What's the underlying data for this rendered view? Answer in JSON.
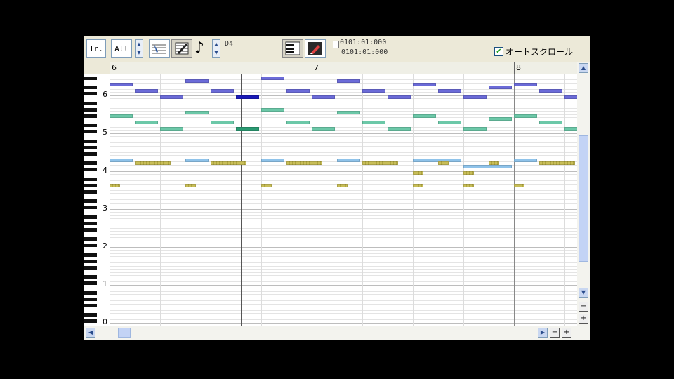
{
  "toolbar": {
    "track_button": "Tr.",
    "track_select": "All",
    "note_length": "D4",
    "position_top": "0101:01:000",
    "position_bottom": "0101:01:000",
    "autoscroll_label": "オートスクロール",
    "autoscroll_checked": true
  },
  "ruler": {
    "measures": [
      "6",
      "7",
      "8"
    ]
  },
  "keyboard": {
    "octaves": [
      "6",
      "5",
      "4",
      "3",
      "2",
      "1",
      "0"
    ]
  },
  "colors": {
    "purple": "#6b6bd8",
    "dark_blue": "#1a1ab8",
    "teal": "#6cc8a8",
    "dark_teal": "#2a9a72",
    "light_blue": "#8fc3ea",
    "olive": "#c8be58"
  },
  "piano_roll": {
    "notes": [
      {
        "beat": 0.0,
        "len": 0.5,
        "pitch": 88,
        "color": "purple"
      },
      {
        "beat": 0.5,
        "len": 0.5,
        "pitch": 86,
        "color": "purple"
      },
      {
        "beat": 1.0,
        "len": 0.5,
        "pitch": 84,
        "color": "purple"
      },
      {
        "beat": 1.5,
        "len": 0.5,
        "pitch": 89,
        "color": "purple"
      },
      {
        "beat": 2.0,
        "len": 0.5,
        "pitch": 86,
        "color": "purple"
      },
      {
        "beat": 2.5,
        "len": 0.5,
        "pitch": 84,
        "color": "dark_blue"
      },
      {
        "beat": 3.0,
        "len": 0.5,
        "pitch": 90,
        "color": "purple"
      },
      {
        "beat": 3.5,
        "len": 0.5,
        "pitch": 86,
        "color": "purple"
      },
      {
        "beat": 4.0,
        "len": 0.5,
        "pitch": 84,
        "color": "purple"
      },
      {
        "beat": 4.5,
        "len": 0.5,
        "pitch": 89,
        "color": "purple"
      },
      {
        "beat": 5.0,
        "len": 0.5,
        "pitch": 86,
        "color": "purple"
      },
      {
        "beat": 5.5,
        "len": 0.5,
        "pitch": 84,
        "color": "purple"
      },
      {
        "beat": 6.0,
        "len": 0.5,
        "pitch": 88,
        "color": "purple"
      },
      {
        "beat": 6.5,
        "len": 0.5,
        "pitch": 86,
        "color": "purple"
      },
      {
        "beat": 7.0,
        "len": 0.5,
        "pitch": 84,
        "color": "purple"
      },
      {
        "beat": 7.5,
        "len": 0.5,
        "pitch": 87,
        "color": "purple"
      },
      {
        "beat": 8.0,
        "len": 0.5,
        "pitch": 88,
        "color": "purple"
      },
      {
        "beat": 8.5,
        "len": 0.5,
        "pitch": 86,
        "color": "purple"
      },
      {
        "beat": 9.0,
        "len": 0.3,
        "pitch": 84,
        "color": "purple"
      },
      {
        "beat": 0.0,
        "len": 0.5,
        "pitch": 78,
        "color": "teal"
      },
      {
        "beat": 0.5,
        "len": 0.5,
        "pitch": 76,
        "color": "teal"
      },
      {
        "beat": 1.0,
        "len": 0.5,
        "pitch": 74,
        "color": "teal"
      },
      {
        "beat": 1.5,
        "len": 0.5,
        "pitch": 79,
        "color": "teal"
      },
      {
        "beat": 2.0,
        "len": 0.5,
        "pitch": 76,
        "color": "teal"
      },
      {
        "beat": 2.5,
        "len": 0.5,
        "pitch": 74,
        "color": "dark_teal"
      },
      {
        "beat": 3.0,
        "len": 0.5,
        "pitch": 80,
        "color": "teal"
      },
      {
        "beat": 3.5,
        "len": 0.5,
        "pitch": 76,
        "color": "teal"
      },
      {
        "beat": 4.0,
        "len": 0.5,
        "pitch": 74,
        "color": "teal"
      },
      {
        "beat": 4.5,
        "len": 0.5,
        "pitch": 79,
        "color": "teal"
      },
      {
        "beat": 5.0,
        "len": 0.5,
        "pitch": 76,
        "color": "teal"
      },
      {
        "beat": 5.5,
        "len": 0.5,
        "pitch": 74,
        "color": "teal"
      },
      {
        "beat": 6.0,
        "len": 0.5,
        "pitch": 78,
        "color": "teal"
      },
      {
        "beat": 6.5,
        "len": 0.5,
        "pitch": 76,
        "color": "teal"
      },
      {
        "beat": 7.0,
        "len": 0.5,
        "pitch": 74,
        "color": "teal"
      },
      {
        "beat": 7.5,
        "len": 0.5,
        "pitch": 77,
        "color": "teal"
      },
      {
        "beat": 8.0,
        "len": 0.5,
        "pitch": 78,
        "color": "teal"
      },
      {
        "beat": 8.5,
        "len": 0.5,
        "pitch": 76,
        "color": "teal"
      },
      {
        "beat": 9.0,
        "len": 0.3,
        "pitch": 74,
        "color": "teal"
      },
      {
        "beat": 0.0,
        "len": 0.5,
        "pitch": 64,
        "color": "light_blue"
      },
      {
        "beat": 1.5,
        "len": 0.5,
        "pitch": 64,
        "color": "light_blue"
      },
      {
        "beat": 3.0,
        "len": 0.5,
        "pitch": 64,
        "color": "light_blue"
      },
      {
        "beat": 4.5,
        "len": 0.5,
        "pitch": 64,
        "color": "light_blue"
      },
      {
        "beat": 6.0,
        "len": 1.0,
        "pitch": 64,
        "color": "light_blue"
      },
      {
        "beat": 7.0,
        "len": 1.0,
        "pitch": 62,
        "color": "light_blue"
      },
      {
        "beat": 8.0,
        "len": 0.5,
        "pitch": 64,
        "color": "light_blue"
      },
      {
        "beat": 0.5,
        "len": 0.75,
        "pitch": 63,
        "color": "olive"
      },
      {
        "beat": 2.0,
        "len": 0.75,
        "pitch": 63,
        "color": "olive"
      },
      {
        "beat": 3.5,
        "len": 0.75,
        "pitch": 63,
        "color": "olive"
      },
      {
        "beat": 5.0,
        "len": 0.75,
        "pitch": 63,
        "color": "olive"
      },
      {
        "beat": 6.5,
        "len": 0.25,
        "pitch": 63,
        "color": "olive"
      },
      {
        "beat": 7.5,
        "len": 0.25,
        "pitch": 63,
        "color": "olive"
      },
      {
        "beat": 8.5,
        "len": 0.75,
        "pitch": 63,
        "color": "olive"
      },
      {
        "beat": 6.0,
        "len": 0.25,
        "pitch": 60,
        "color": "olive"
      },
      {
        "beat": 7.0,
        "len": 0.25,
        "pitch": 60,
        "color": "olive"
      },
      {
        "beat": 0.0,
        "len": 0.25,
        "pitch": 56,
        "color": "olive"
      },
      {
        "beat": 1.5,
        "len": 0.25,
        "pitch": 56,
        "color": "olive"
      },
      {
        "beat": 3.0,
        "len": 0.25,
        "pitch": 56,
        "color": "olive"
      },
      {
        "beat": 4.5,
        "len": 0.25,
        "pitch": 56,
        "color": "olive"
      },
      {
        "beat": 6.0,
        "len": 0.25,
        "pitch": 56,
        "color": "olive"
      },
      {
        "beat": 7.0,
        "len": 0.25,
        "pitch": 56,
        "color": "olive"
      },
      {
        "beat": 8.0,
        "len": 0.25,
        "pitch": 56,
        "color": "olive"
      }
    ]
  }
}
